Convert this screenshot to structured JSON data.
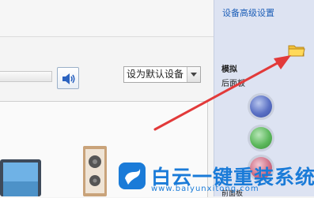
{
  "sidebar": {
    "link_device_settings": "设备高级设置",
    "section_title": "模拟",
    "section_sub": "后面板",
    "bottom_label": "前面板"
  },
  "main": {
    "device_select_value": "设为默认设备"
  },
  "watermark": {
    "brand": "白云一键重装系统",
    "url": "www.baiyunxitong.com"
  },
  "colors": {
    "arrow": "#e23a3a",
    "sidebar_bg": "#dde3f2",
    "link": "#1d5fb8",
    "watermark": "#1a7bd8"
  },
  "icons": [
    "speaker-icon",
    "folder-icon",
    "jack-blue-icon",
    "jack-green-icon",
    "jack-pink-icon"
  ]
}
